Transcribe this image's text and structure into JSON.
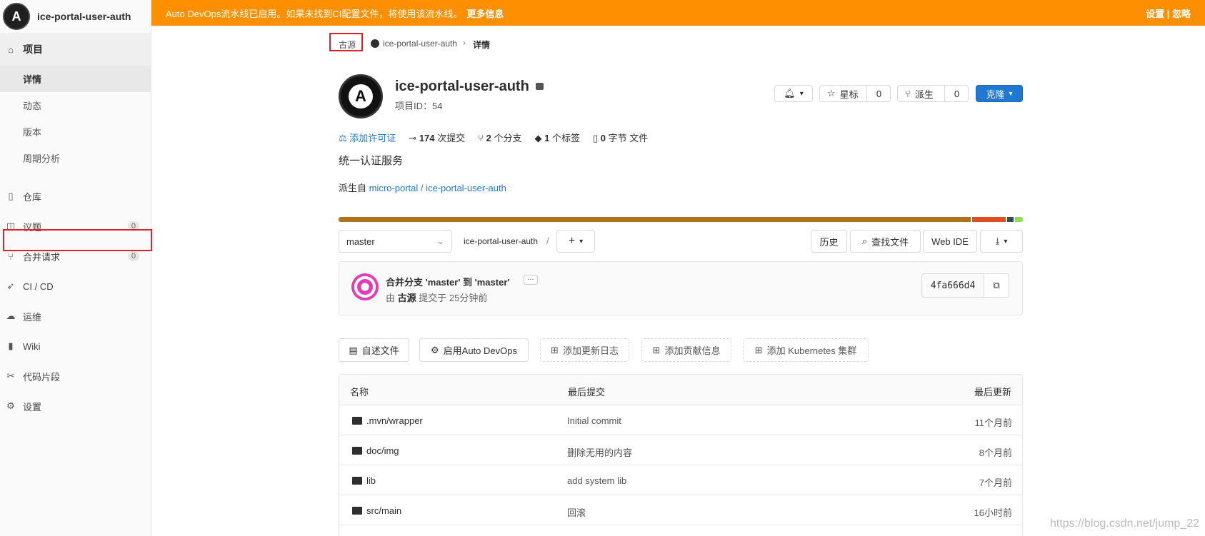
{
  "sidebar": {
    "project_name": "ice-portal-user-auth",
    "avatar_letter": "A",
    "project_label": "项目",
    "sub_items": [
      "详情",
      "动态",
      "版本",
      "周期分析"
    ],
    "repo": "仓库",
    "issues": "议题",
    "issues_count": "0",
    "mr": "合并请求",
    "mr_count": "0",
    "cicd": "CI / CD",
    "ops": "运维",
    "wiki": "Wiki",
    "snippets": "代码片段",
    "settings": "设置"
  },
  "banner": {
    "text": "Auto DevOps流水线已启用。如果未找到CI配置文件，将使用该流水线。",
    "more": "更多信息",
    "right": "设置 | 忽略"
  },
  "breadcrumb": {
    "group": "古源",
    "project": "ice-portal-user-auth",
    "current": "详情"
  },
  "project": {
    "title": "ice-portal-user-auth",
    "id_text": "项目ID：54",
    "star_label": "星标",
    "star_count": "0",
    "fork_label": "派生",
    "fork_count": "0",
    "clone_label": "克隆",
    "license": "添加许可证",
    "commits_num": "174",
    "commits_label": "次提交",
    "branches_num": "2",
    "branches_label": "个分支",
    "tags_num": "1",
    "tags_label": "个标签",
    "files_num": "0",
    "files_label": "字节 文件",
    "description": "统一认证服务",
    "forked_prefix": "派生自",
    "forked_link": "micro-portal / ice-portal-user-auth"
  },
  "languages": [
    {
      "color": "#b07219",
      "share": 0.93
    },
    {
      "color": "#e44b23",
      "share": 0.049
    },
    {
      "color": "#384d54",
      "share": 0.009
    },
    {
      "color": "#89e051",
      "share": 0.012
    }
  ],
  "toolbar": {
    "branch": "master",
    "path": "ice-portal-user-auth",
    "separator": "/",
    "history": "历史",
    "find_file": "查找文件",
    "web_ide": "Web IDE"
  },
  "commit": {
    "message": "合并分支 'master' 到 'master'",
    "by": "由",
    "author": "古源",
    "time": "提交于 25分钟前",
    "sha": "4fa666d4"
  },
  "actions": {
    "readme": "自述文件",
    "autodevops": "启用Auto DevOps",
    "changelog": "添加更新日志",
    "contributing": "添加贡献信息",
    "k8s": "添加 Kubernetes 集群"
  },
  "table": {
    "headers": [
      "名称",
      "最后提交",
      "最后更新"
    ],
    "rows": [
      {
        "name": ".mvn/wrapper",
        "commit": "Initial commit",
        "updated": "11个月前"
      },
      {
        "name": "doc/img",
        "commit": "删除无用的内容",
        "updated": "8个月前"
      },
      {
        "name": "lib",
        "commit": "add system lib",
        "updated": "7个月前"
      },
      {
        "name": "src/main",
        "commit": "回滚",
        "updated": "16小时前"
      }
    ]
  },
  "watermark": "https://blog.csdn.net/jump_22"
}
